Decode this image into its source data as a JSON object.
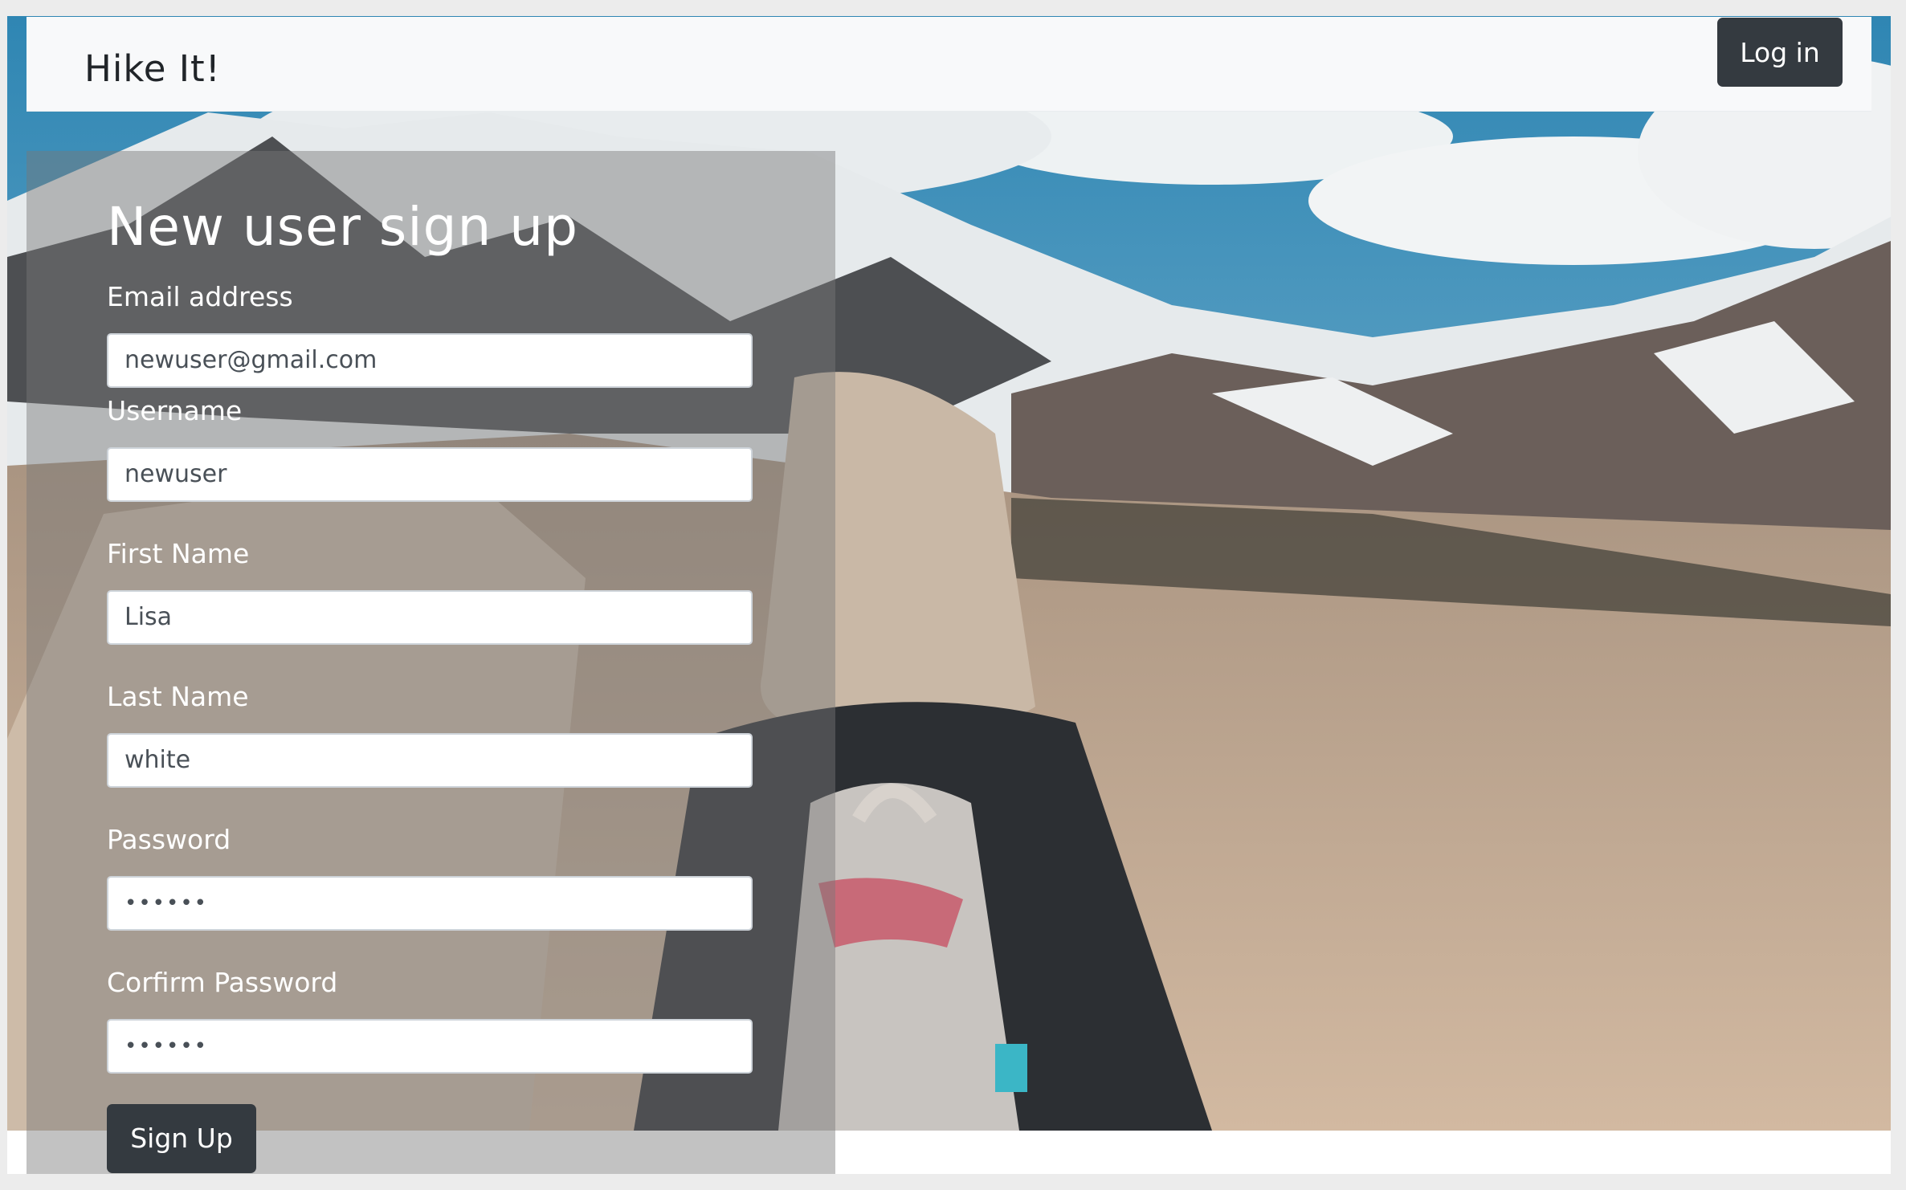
{
  "navbar": {
    "brand": "Hike It!",
    "login_label": "Log in"
  },
  "form": {
    "title": "New user sign up",
    "fields": [
      {
        "label": "Email address",
        "value": "newuser@gmail.com"
      },
      {
        "label": "Username",
        "value": "newuser"
      },
      {
        "label": "First Name",
        "value": "Lisa"
      },
      {
        "label": "Last Name",
        "value": "white"
      },
      {
        "label": "Password",
        "value": "••••••"
      },
      {
        "label": "Corfirm Password",
        "value": "••••••"
      }
    ],
    "submit_label": "Sign Up"
  },
  "colors": {
    "navbar_bg": "#f8f9fa",
    "button_bg": "#343a40",
    "panel_overlay": "rgba(120,120,120,0.45)"
  },
  "background_image": "woman-with-backpack-hiking-snowy-mountains"
}
